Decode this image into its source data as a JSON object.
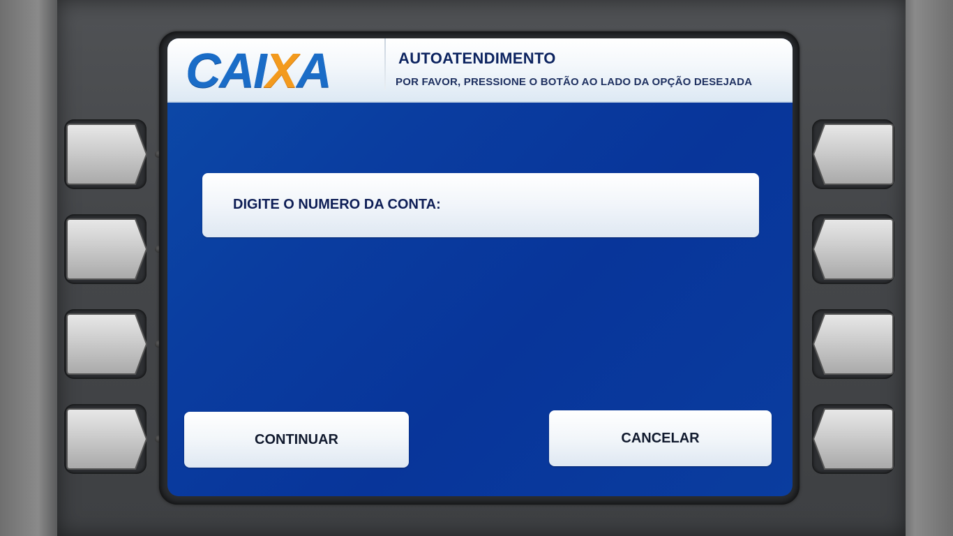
{
  "header": {
    "logo_text_left": "CAI",
    "logo_text_x": "X",
    "logo_text_right": "A",
    "title": "AUTOATENDIMENTO",
    "subtitle": "POR FAVOR, PRESSIONE O BOTÃO AO LADO DA OPÇÃO DESEJADA"
  },
  "prompt": {
    "label": "DIGITE O NUMERO DA CONTA:",
    "value": ""
  },
  "buttons": {
    "continue_label": "CONTINUAR",
    "cancel_label": "CANCELAR"
  },
  "side_keys": {
    "left": [
      "key-1",
      "key-2",
      "key-3",
      "key-4"
    ],
    "right": [
      "key-1",
      "key-2",
      "key-3",
      "key-4"
    ]
  },
  "colors": {
    "screen_blue": "#0a3da0",
    "logo_blue": "#1a6cc7",
    "logo_orange": "#f39a1d",
    "text_navy": "#0d1d55"
  }
}
